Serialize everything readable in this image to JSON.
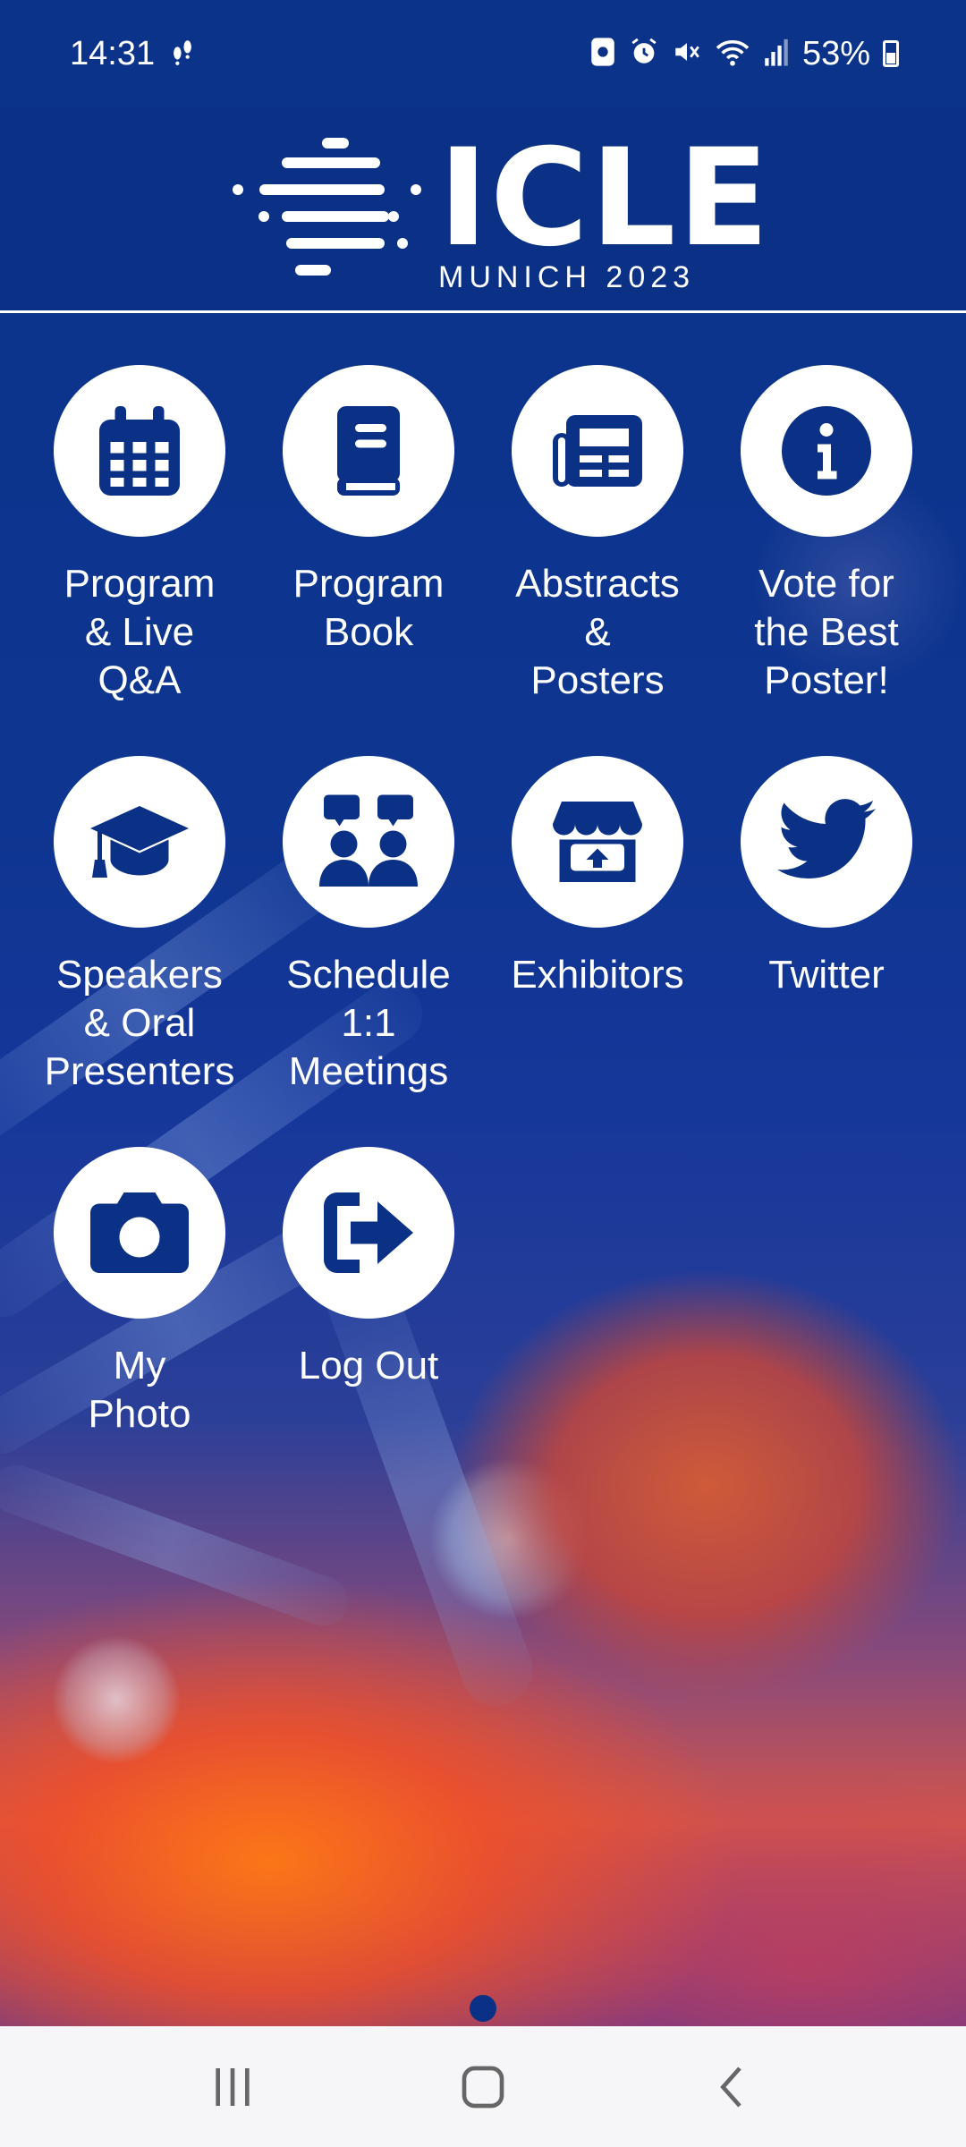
{
  "status_bar": {
    "time": "14:31",
    "battery": "53%",
    "icons": [
      "step-counter-icon",
      "screen-record-icon",
      "alarm-icon",
      "mute-icon",
      "wifi-icon",
      "signal-icon",
      "battery-icon"
    ]
  },
  "header": {
    "logo_text": "ICLE",
    "logo_subtitle": "MUNICH 2023"
  },
  "tiles": [
    {
      "label": "Program\n& Live\nQ&A",
      "icon": "calendar-icon"
    },
    {
      "label": "Program\nBook",
      "icon": "book-icon"
    },
    {
      "label": "Abstracts\n&\nPosters",
      "icon": "newspaper-icon"
    },
    {
      "label": "Vote for\nthe Best\nPoster!",
      "icon": "info-icon"
    },
    {
      "label": "Speakers\n& Oral\nPresenters",
      "icon": "graduation-cap-icon"
    },
    {
      "label": "Schedule\n1:1\nMeetings",
      "icon": "meeting-icon"
    },
    {
      "label": "Exhibitors",
      "icon": "store-icon"
    },
    {
      "label": "Twitter",
      "icon": "twitter-icon"
    },
    {
      "label": "My\nPhoto",
      "icon": "camera-icon"
    },
    {
      "label": "Log Out",
      "icon": "logout-icon"
    }
  ],
  "nav_bar": {
    "buttons": [
      "recent-apps-icon",
      "home-icon",
      "back-icon"
    ]
  },
  "colors": {
    "primary": "#0a3185",
    "icon_fill": "#0a3185",
    "nav_background": "#f6f6f8"
  }
}
